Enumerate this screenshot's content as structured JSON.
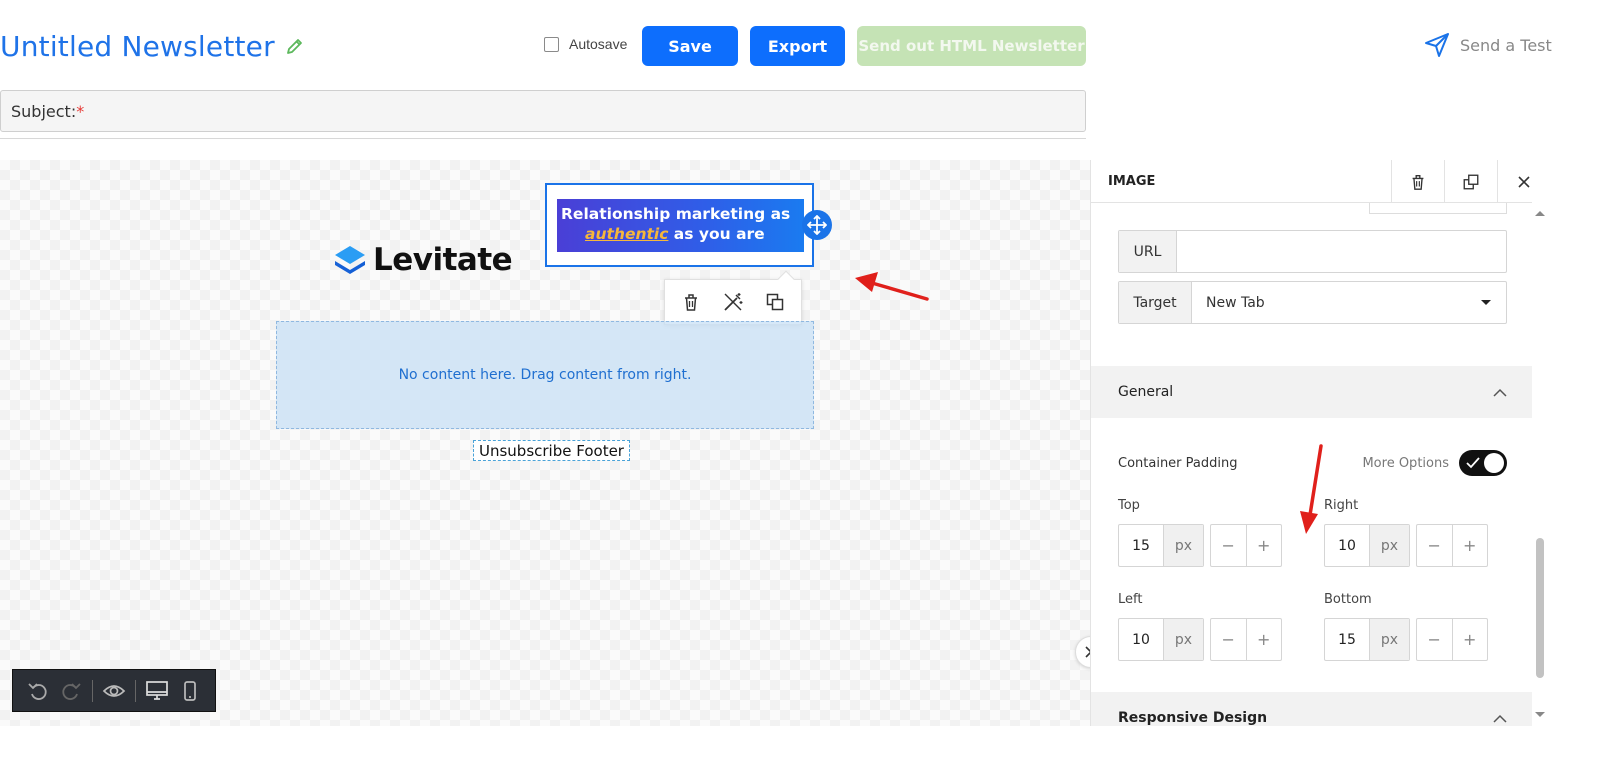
{
  "header": {
    "title": "Untitled Newsletter",
    "autosave_label": "Autosave",
    "save_label": "Save",
    "export_label": "Export",
    "send_label": "Send out HTML Newsletter",
    "send_test_label": "Send a Test"
  },
  "subject": {
    "label": "Subject:",
    "required_mark": "*"
  },
  "canvas": {
    "logo_text": "Levitate",
    "banner_line1": "Relationship marketing as",
    "banner_em": "authentic",
    "banner_line2_rest": " as you are",
    "dropzone_text": "No content here. Drag content from right.",
    "unsubscribe_text": "Unsubscribe Footer"
  },
  "panel": {
    "title": "IMAGE",
    "url_label": "URL",
    "url_value": "",
    "target_label": "Target",
    "target_value": "New Tab",
    "general_label": "General",
    "container_padding_label": "Container Padding",
    "more_options_label": "More Options",
    "more_options_on": true,
    "padding": {
      "top_label": "Top",
      "top_value": "15",
      "right_label": "Right",
      "right_value": "10",
      "left_label": "Left",
      "left_value": "10",
      "bottom_label": "Bottom",
      "bottom_value": "15",
      "unit": "px"
    },
    "responsive_label": "Responsive Design"
  },
  "colors": {
    "primary": "#0d6efd",
    "title_blue": "#1f73e8",
    "send_disabled": "#c5e3b5",
    "annotation_red": "#e0201b"
  },
  "icons": [
    "pencil-icon",
    "send-icon",
    "trash-icon",
    "duplicate-icon",
    "close-icon",
    "move-icon",
    "magic-wand-icon",
    "undo-icon",
    "redo-icon",
    "eye-icon",
    "desktop-icon",
    "mobile-icon",
    "chevron-down-icon",
    "chevron-up-icon",
    "double-chevron-right-icon"
  ]
}
